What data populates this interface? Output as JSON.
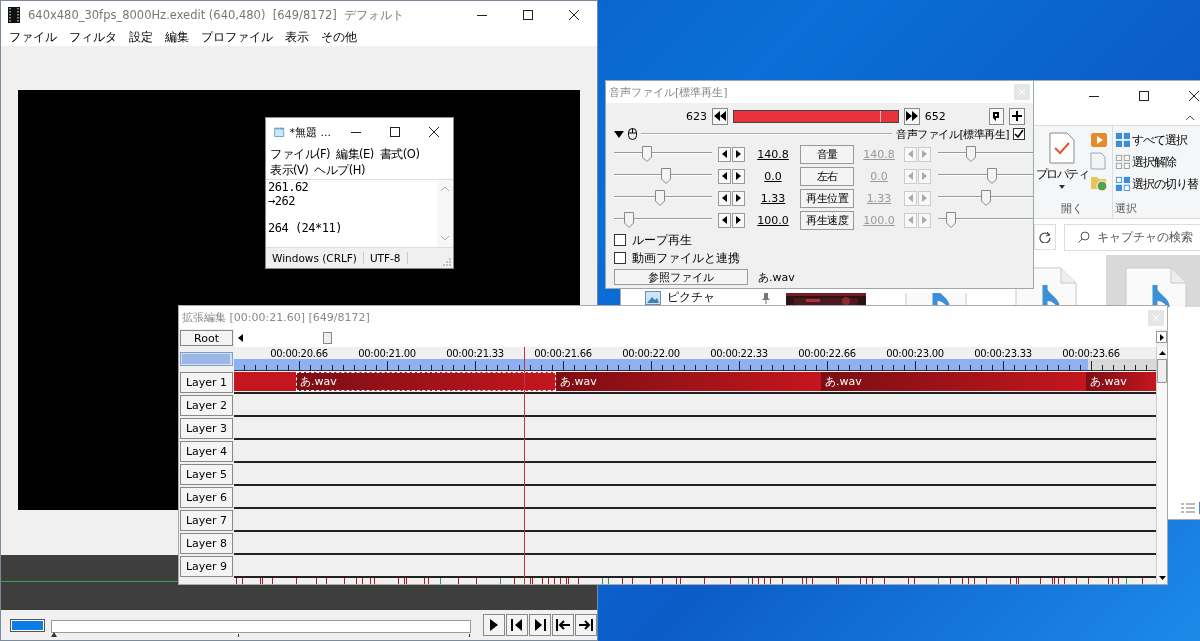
{
  "main_window": {
    "title": "640x480_30fps_8000Hz.exedit (640,480)  [649/8172]  デフォルト",
    "menu": [
      "ファイル",
      "フィルタ",
      "設定",
      "編集",
      "プロファイル",
      "表示",
      "その他"
    ],
    "seek": {
      "level": 0.0
    }
  },
  "explorer": {
    "open_group": {
      "label": "開く",
      "large_button": "プロパティ"
    },
    "select_group": {
      "label": "選択",
      "items": [
        "すべて選択",
        "選択解除",
        "選択の切り替"
      ]
    },
    "search": {
      "placeholder": "キャプチャの検索"
    },
    "nav_items": [
      "ピクチャ"
    ],
    "files": [
      {
        "kind": "picture",
        "selected": false
      },
      {
        "kind": "audio",
        "selected": false
      },
      {
        "kind": "audio",
        "selected": false
      },
      {
        "kind": "audio",
        "selected": true
      }
    ]
  },
  "notepad": {
    "title": "*無題 ...",
    "menu": [
      "ファイル(F)",
      "編集(E)",
      "書式(O)",
      "表示(V)",
      "ヘルプ(H)"
    ],
    "text": "261.62\n→262\n\n264 (24*11)",
    "status": [
      "Windows (CRLF)",
      "UTF-8"
    ]
  },
  "audio_dialog": {
    "title": "音声ファイル[標準再生]",
    "range_start": "623",
    "range_end": "652",
    "range_position": {
      "level": 0.89
    },
    "object_label": "音声ファイル[標準再生]",
    "object_enabled": true,
    "params": [
      {
        "name": "音量",
        "start": {
          "value": "140.8",
          "level": 0.34
        },
        "end": {
          "value": "140.8",
          "level": 0.33
        }
      },
      {
        "name": "左右",
        "start": {
          "value": "0.0",
          "level": 0.53
        },
        "end": {
          "value": "0.0",
          "level": 0.54
        }
      },
      {
        "name": "再生位置",
        "start": {
          "value": "1.33",
          "level": 0.47
        },
        "end": {
          "value": "1.33",
          "level": 0.48
        }
      },
      {
        "name": "再生速度",
        "start": {
          "value": "100.0",
          "level": 0.15
        },
        "end": {
          "value": "100.0",
          "level": 0.13
        }
      }
    ],
    "options": [
      {
        "label": "ループ再生",
        "checked": false
      },
      {
        "label": "動画ファイルと連携",
        "checked": false
      }
    ],
    "file_button": "参照ファイル",
    "file_name": "あ.wav"
  },
  "timeline": {
    "title": "拡張編集 [00:00:21.60] [649/8172]",
    "root_button": "Root",
    "ruler": [
      "00:00:20.66",
      "00:00:21.00",
      "00:00:21.33",
      "00:00:21.66",
      "00:00:22.00",
      "00:00:22.33",
      "00:00:22.66",
      "00:00:23.00",
      "00:00:23.33",
      "00:00:23.66"
    ],
    "playhead": {
      "level": 0.315
    },
    "layers": [
      {
        "name": "Layer 1",
        "clips": [
          {
            "selected": false
          },
          {
            "label": "あ.wav",
            "selected": true
          },
          {
            "label": "あ.wav",
            "selected": false
          },
          {
            "label": "あ.wav",
            "selected": false
          },
          {
            "label": "あ.wav",
            "selected": false
          }
        ]
      },
      {
        "name": "Layer 2"
      },
      {
        "name": "Layer 3"
      },
      {
        "name": "Layer 4"
      },
      {
        "name": "Layer 5"
      },
      {
        "name": "Layer 6"
      },
      {
        "name": "Layer 7"
      },
      {
        "name": "Layer 8"
      },
      {
        "name": "Layer 9"
      }
    ]
  }
}
